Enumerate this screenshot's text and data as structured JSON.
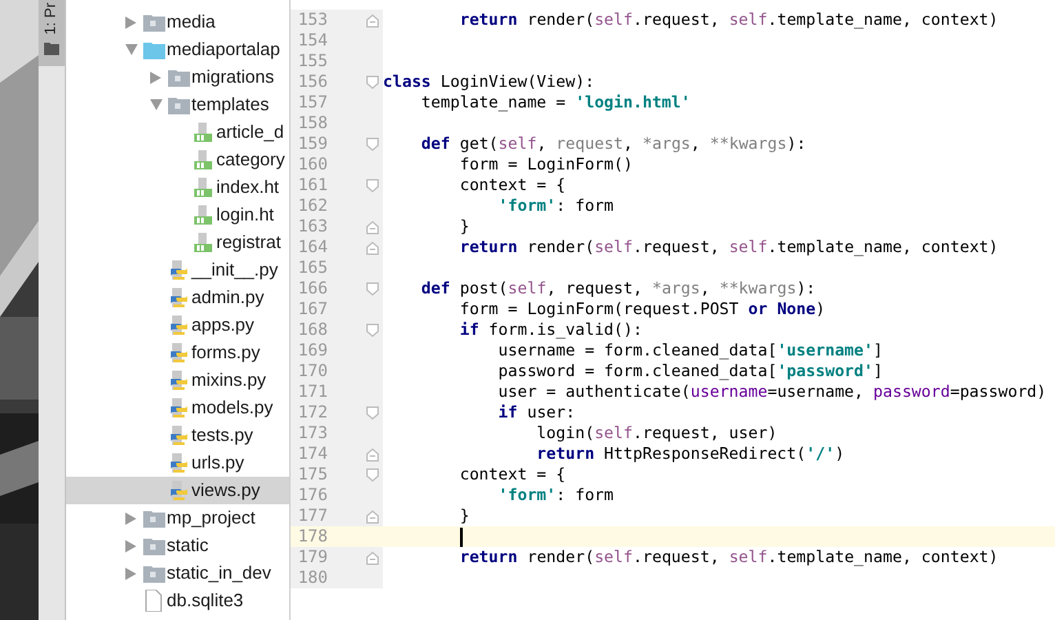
{
  "tool_window_bar": {
    "tab": {
      "label": "1: Pr",
      "selected": true
    }
  },
  "project_tree": {
    "items": [
      {
        "label": "media",
        "kind": "folder",
        "expanded": false,
        "selected": false
      },
      {
        "label": "mediaportalap",
        "kind": "source_folder",
        "expanded": true,
        "selected": false,
        "children": [
          {
            "label": "migrations",
            "kind": "folder",
            "expanded": false,
            "selected": false
          },
          {
            "label": "templates",
            "kind": "folder",
            "expanded": true,
            "selected": false,
            "children": [
              {
                "label": "article_d",
                "kind": "html",
                "selected": false
              },
              {
                "label": "category",
                "kind": "html",
                "selected": false
              },
              {
                "label": "index.ht",
                "kind": "html",
                "selected": false
              },
              {
                "label": "login.ht",
                "kind": "html",
                "selected": false
              },
              {
                "label": "registrat",
                "kind": "html",
                "selected": false
              }
            ]
          },
          {
            "label": "__init__.py",
            "kind": "python",
            "selected": false
          },
          {
            "label": "admin.py",
            "kind": "python",
            "selected": false
          },
          {
            "label": "apps.py",
            "kind": "python",
            "selected": false
          },
          {
            "label": "forms.py",
            "kind": "python",
            "selected": false
          },
          {
            "label": "mixins.py",
            "kind": "python",
            "selected": false
          },
          {
            "label": "models.py",
            "kind": "python",
            "selected": false
          },
          {
            "label": "tests.py",
            "kind": "python",
            "selected": false
          },
          {
            "label": "urls.py",
            "kind": "python",
            "selected": false
          },
          {
            "label": "views.py",
            "kind": "python",
            "selected": true
          }
        ]
      },
      {
        "label": "mp_project",
        "kind": "folder",
        "expanded": false,
        "selected": false
      },
      {
        "label": "static",
        "kind": "folder",
        "expanded": false,
        "selected": false
      },
      {
        "label": "static_in_dev",
        "kind": "folder",
        "expanded": false,
        "selected": false
      },
      {
        "label": "db.sqlite3",
        "kind": "file",
        "selected": false
      }
    ]
  },
  "editor": {
    "lines": [
      {
        "number": "153",
        "fold_end": true,
        "tokens": [
          {
            "text": "        return",
            "kind": "keyword"
          },
          {
            "text": " render(",
            "kind": "plain"
          },
          {
            "text": "self",
            "kind": "self"
          },
          {
            "text": ".request, ",
            "kind": "plain"
          },
          {
            "text": "self",
            "kind": "self"
          },
          {
            "text": ".template_name, context)",
            "kind": "plain"
          }
        ]
      },
      {
        "number": "154"
      },
      {
        "number": "155"
      },
      {
        "number": "156",
        "fold_start": true,
        "tokens": [
          {
            "text": "class",
            "kind": "keyword"
          },
          {
            "text": " LoginView(View):",
            "kind": "plain"
          }
        ]
      },
      {
        "number": "157",
        "tokens": [
          {
            "text": "    template_name = ",
            "kind": "plain"
          },
          {
            "text": "'login.html'",
            "kind": "string"
          }
        ]
      },
      {
        "number": "158"
      },
      {
        "number": "159",
        "fold_start": true,
        "tokens": [
          {
            "text": "    def",
            "kind": "keyword"
          },
          {
            "text": " get(",
            "kind": "plain"
          },
          {
            "text": "self",
            "kind": "self"
          },
          {
            "text": ", ",
            "kind": "plain"
          },
          {
            "text": "request",
            "kind": "unused"
          },
          {
            "text": ", ",
            "kind": "plain"
          },
          {
            "text": "*args",
            "kind": "unused"
          },
          {
            "text": ", ",
            "kind": "plain"
          },
          {
            "text": "**kwargs",
            "kind": "unused"
          },
          {
            "text": "):",
            "kind": "plain"
          }
        ]
      },
      {
        "number": "160",
        "tokens": [
          {
            "text": "        form = LoginForm()",
            "kind": "plain"
          }
        ]
      },
      {
        "number": "161",
        "fold_start": true,
        "tokens": [
          {
            "text": "        context = {",
            "kind": "plain"
          }
        ]
      },
      {
        "number": "162",
        "tokens": [
          {
            "text": "            'form'",
            "kind": "string"
          },
          {
            "text": ": form",
            "kind": "plain"
          }
        ]
      },
      {
        "number": "163",
        "fold_end": true,
        "tokens": [
          {
            "text": "        }",
            "kind": "plain"
          }
        ]
      },
      {
        "number": "164",
        "fold_end": true,
        "tokens": [
          {
            "text": "        return",
            "kind": "keyword"
          },
          {
            "text": " render(",
            "kind": "plain"
          },
          {
            "text": "self",
            "kind": "self"
          },
          {
            "text": ".request, ",
            "kind": "plain"
          },
          {
            "text": "self",
            "kind": "self"
          },
          {
            "text": ".template_name, context)",
            "kind": "plain"
          }
        ]
      },
      {
        "number": "165"
      },
      {
        "number": "166",
        "fold_start": true,
        "tokens": [
          {
            "text": "    def",
            "kind": "keyword"
          },
          {
            "text": " post(",
            "kind": "plain"
          },
          {
            "text": "self",
            "kind": "self"
          },
          {
            "text": ", request, ",
            "kind": "plain"
          },
          {
            "text": "*args",
            "kind": "unused"
          },
          {
            "text": ", ",
            "kind": "plain"
          },
          {
            "text": "**kwargs",
            "kind": "unused"
          },
          {
            "text": "):",
            "kind": "plain"
          }
        ]
      },
      {
        "number": "167",
        "tokens": [
          {
            "text": "        form = LoginForm(request.POST ",
            "kind": "plain"
          },
          {
            "text": "or None",
            "kind": "keyword"
          },
          {
            "text": ")",
            "kind": "plain"
          }
        ]
      },
      {
        "number": "168",
        "fold_start": true,
        "tokens": [
          {
            "text": "        if",
            "kind": "keyword"
          },
          {
            "text": " form.is_valid():",
            "kind": "plain"
          }
        ]
      },
      {
        "number": "169",
        "tokens": [
          {
            "text": "            username = form.cleaned_data[",
            "kind": "plain"
          },
          {
            "text": "'username'",
            "kind": "string"
          },
          {
            "text": "]",
            "kind": "plain"
          }
        ]
      },
      {
        "number": "170",
        "tokens": [
          {
            "text": "            password = form.cleaned_data[",
            "kind": "plain"
          },
          {
            "text": "'password'",
            "kind": "string"
          },
          {
            "text": "]",
            "kind": "plain"
          }
        ]
      },
      {
        "number": "171",
        "tokens": [
          {
            "text": "            user = authenticate(",
            "kind": "plain"
          },
          {
            "text": "username",
            "kind": "named_arg"
          },
          {
            "text": "=username, ",
            "kind": "plain"
          },
          {
            "text": "password",
            "kind": "named_arg"
          },
          {
            "text": "=password)",
            "kind": "plain"
          }
        ]
      },
      {
        "number": "172",
        "fold_start": true,
        "tokens": [
          {
            "text": "            if",
            "kind": "keyword"
          },
          {
            "text": " user:",
            "kind": "plain"
          }
        ]
      },
      {
        "number": "173",
        "tokens": [
          {
            "text": "                login(",
            "kind": "plain"
          },
          {
            "text": "self",
            "kind": "self"
          },
          {
            "text": ".request, user)",
            "kind": "plain"
          }
        ]
      },
      {
        "number": "174",
        "fold_end": true,
        "tokens": [
          {
            "text": "                return",
            "kind": "keyword"
          },
          {
            "text": " HttpResponseRedirect(",
            "kind": "plain"
          },
          {
            "text": "'/'",
            "kind": "string"
          },
          {
            "text": ")",
            "kind": "plain"
          }
        ]
      },
      {
        "number": "175",
        "fold_start": true,
        "tokens": [
          {
            "text": "        context = {",
            "kind": "plain"
          }
        ]
      },
      {
        "number": "176",
        "tokens": [
          {
            "text": "            'form'",
            "kind": "string"
          },
          {
            "text": ": form",
            "kind": "plain"
          }
        ]
      },
      {
        "number": "177",
        "fold_end": true,
        "tokens": [
          {
            "text": "        }",
            "kind": "plain"
          }
        ]
      },
      {
        "number": "178",
        "current": true
      },
      {
        "number": "179",
        "fold_end": true,
        "tokens": [
          {
            "text": "        return",
            "kind": "keyword"
          },
          {
            "text": " render(",
            "kind": "plain"
          },
          {
            "text": "self",
            "kind": "self"
          },
          {
            "text": ".request, ",
            "kind": "plain"
          },
          {
            "text": "self",
            "kind": "self"
          },
          {
            "text": ".template_name, context)",
            "kind": "plain"
          }
        ]
      },
      {
        "number": "180"
      }
    ]
  }
}
